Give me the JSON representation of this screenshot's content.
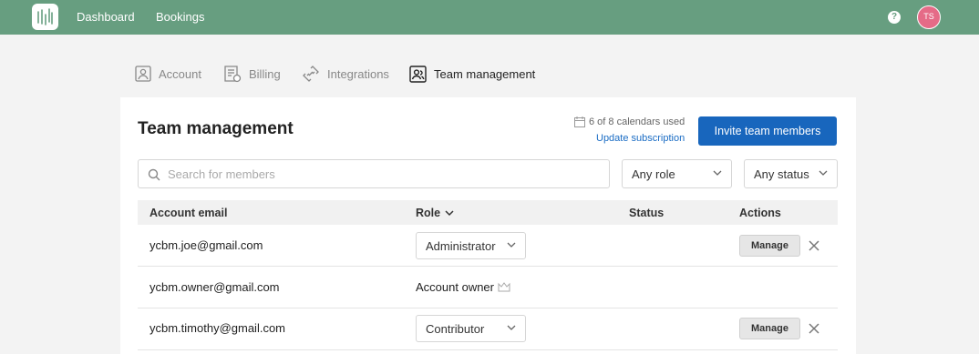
{
  "nav": {
    "links": [
      "Dashboard",
      "Bookings"
    ],
    "avatar_initials": "TS",
    "help_label": "?"
  },
  "tabs": [
    {
      "label": "Account",
      "icon": "account-icon",
      "active": false
    },
    {
      "label": "Billing",
      "icon": "billing-icon",
      "active": false
    },
    {
      "label": "Integrations",
      "icon": "integrations-icon",
      "active": false
    },
    {
      "label": "Team management",
      "icon": "team-icon",
      "active": true
    }
  ],
  "main": {
    "title": "Team management",
    "calendar_usage": "6 of 8 calendars used",
    "update_link": "Update subscription",
    "invite_button": "Invite team members"
  },
  "filters": {
    "search_placeholder": "Search for members",
    "search_value": "",
    "role_filter": "Any role",
    "status_filter": "Any status"
  },
  "table": {
    "headers": {
      "email": "Account email",
      "role": "Role",
      "status": "Status",
      "actions": "Actions"
    },
    "rows": [
      {
        "email": "ycbm.joe@gmail.com",
        "role": "Administrator",
        "role_type": "select",
        "status": "",
        "action": "Manage"
      },
      {
        "email": "ycbm.owner@gmail.com",
        "role": "Account owner",
        "role_type": "text",
        "status": "",
        "action": ""
      },
      {
        "email": "ycbm.timothy@gmail.com",
        "role": "Contributor",
        "role_type": "select",
        "status": "",
        "action": "Manage"
      }
    ]
  },
  "colors": {
    "topbar": "#679e80",
    "primary_button": "#1866bd",
    "link": "#1a6cc4",
    "avatar": "#e56b87"
  }
}
